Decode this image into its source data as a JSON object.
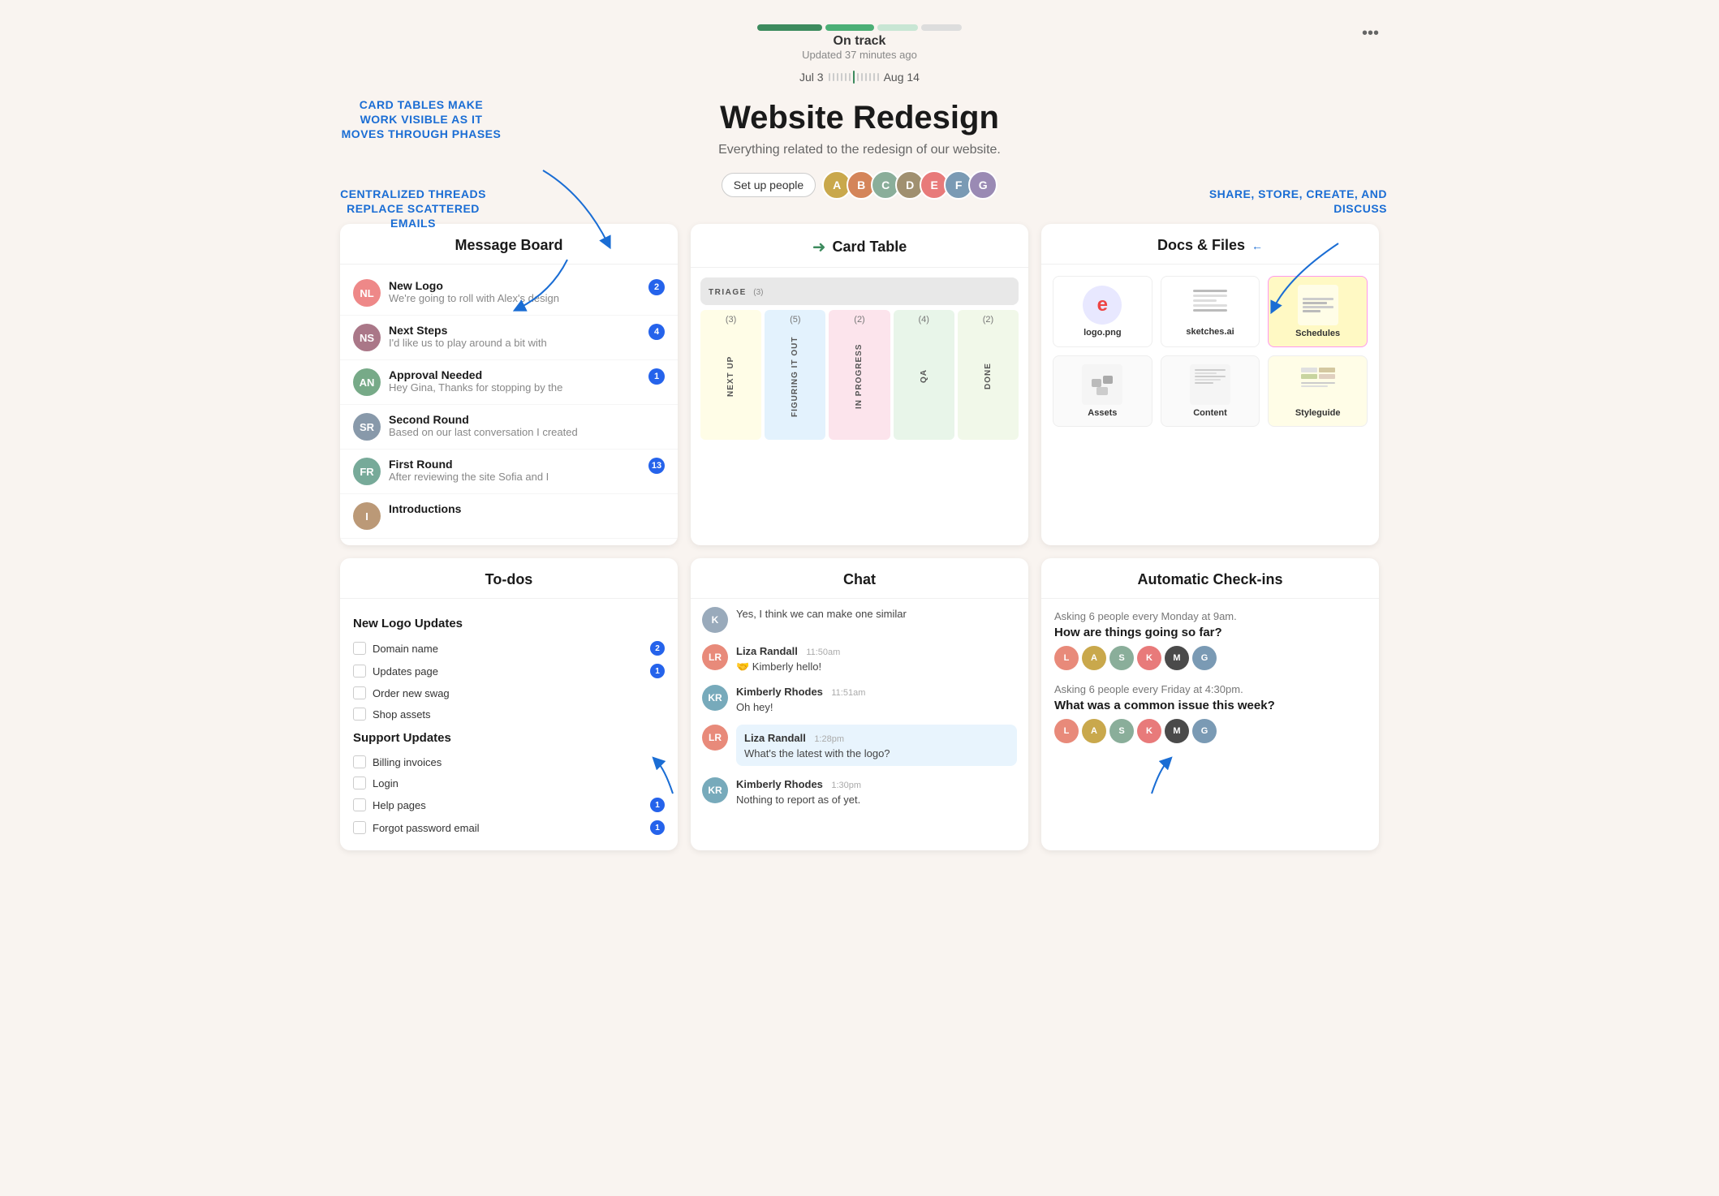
{
  "header": {
    "status_label": "On track",
    "status_updated": "Updated 37 minutes ago",
    "more_icon": "•••",
    "timeline_start": "Jul 3",
    "timeline_end": "Aug 14",
    "project_title": "Website Redesign",
    "project_subtitle": "Everything related to the redesign of our website.",
    "set_up_people": "Set up people"
  },
  "annotations": {
    "ann1": "CARD TABLES MAKE WORK VISIBLE AS IT MOVES THROUGH PHASES",
    "ann2": "CENTRALIZED THREADS REPLACE SCATTERED EMAILS",
    "ann3": "SHARE, STORE, CREATE, AND DISCUSS"
  },
  "message_board": {
    "title": "Message Board",
    "messages": [
      {
        "title": "New Logo",
        "preview": "We're going to roll with Alex's design",
        "badge": "2",
        "color": "#e88"
      },
      {
        "title": "Next Steps",
        "preview": "I'd like us to play around a bit with",
        "badge": "4",
        "color": "#a78"
      },
      {
        "title": "Approval Needed",
        "preview": "Hey Gina, Thanks for stopping by the",
        "badge": "1",
        "color": "#7a8"
      },
      {
        "title": "Second Round",
        "preview": "Based on our last conversation I created",
        "badge": "",
        "color": "#89a"
      },
      {
        "title": "First Round",
        "preview": "After reviewing the site Sofia and I",
        "badge": "13",
        "color": "#7a9"
      },
      {
        "title": "Introductions",
        "preview": "",
        "badge": "",
        "color": "#b97"
      }
    ]
  },
  "card_table": {
    "title": "Card Table",
    "triage_label": "TRIAGE",
    "triage_count": "(3)",
    "columns": [
      {
        "label": "NEXT UP",
        "count": "(3)",
        "color": "col-yellow"
      },
      {
        "label": "FIGURING IT OUT",
        "count": "(5)",
        "color": "col-blue"
      },
      {
        "label": "IN PROGRESS",
        "count": "(2)",
        "color": "col-pink"
      },
      {
        "label": "QA",
        "count": "(4)",
        "color": "col-green-light"
      },
      {
        "label": "DONE",
        "count": "(2)",
        "color": "col-green2"
      }
    ]
  },
  "docs_files": {
    "title": "Docs & Files",
    "items": [
      {
        "name": "logo.png",
        "type": "logo",
        "id": "logo"
      },
      {
        "name": "sketches.ai",
        "type": "sketch",
        "id": "sketch"
      },
      {
        "name": "Schedules",
        "type": "schedules",
        "id": "schedules"
      },
      {
        "name": "Assets",
        "type": "assets",
        "id": "assets"
      },
      {
        "name": "Content",
        "type": "content",
        "id": "content"
      },
      {
        "name": "Styleguide",
        "type": "styleguide",
        "id": "styleguide"
      }
    ]
  },
  "todos": {
    "title": "To-dos",
    "groups": [
      {
        "title": "New Logo Updates",
        "items": [
          {
            "text": "Domain name",
            "badge": "2"
          },
          {
            "text": "Updates page",
            "badge": "1"
          },
          {
            "text": "Order new swag",
            "badge": ""
          },
          {
            "text": "Shop assets",
            "badge": ""
          }
        ]
      },
      {
        "title": "Support Updates",
        "items": [
          {
            "text": "Billing invoices",
            "badge": ""
          },
          {
            "text": "Login",
            "badge": ""
          },
          {
            "text": "Help pages",
            "badge": "1"
          },
          {
            "text": "Forgot password email",
            "badge": "1"
          }
        ]
      }
    ]
  },
  "chat": {
    "title": "Chat",
    "messages": [
      {
        "sender": "",
        "time": "",
        "text": "Yes, I think we can make one similar",
        "avatar_color": "#9ab",
        "initials": "K"
      },
      {
        "sender": "Liza Randall",
        "time": "11:50am",
        "text": "🤝 Kimberly hello!",
        "avatar_color": "#e88a7a",
        "initials": "LR",
        "highlighted": false
      },
      {
        "sender": "Kimberly Rhodes",
        "time": "11:51am",
        "text": "Oh hey!",
        "avatar_color": "#7ab",
        "initials": "KR",
        "highlighted": false
      },
      {
        "sender": "Liza Randall",
        "time": "1:28pm",
        "text": "What's the latest with the logo?",
        "avatar_color": "#e88a7a",
        "initials": "LR",
        "highlighted": true
      },
      {
        "sender": "Kimberly Rhodes",
        "time": "1:30pm",
        "text": "Nothing to report as of yet.",
        "avatar_color": "#7ab",
        "initials": "KR",
        "highlighted": false
      }
    ]
  },
  "checkins": {
    "title": "Automatic Check-ins",
    "sections": [
      {
        "asking": "Asking 6 people every Monday at 9am.",
        "question": "How are things going so far?",
        "avatars": [
          "#e88a7a",
          "#c9a84c",
          "#8aae9a",
          "#e87a7a",
          "#4a4a4a",
          "#7a9ab4"
        ]
      },
      {
        "asking": "Asking 6 people every Friday at 4:30pm.",
        "question": "What was a common issue this week?",
        "avatars": [
          "#e88a7a",
          "#c9a84c",
          "#8aae9a",
          "#e87a7a",
          "#4a4a4a",
          "#7a9ab4"
        ]
      }
    ]
  },
  "avatars": [
    {
      "color": "#c9a84c",
      "initials": "A"
    },
    {
      "color": "#d4855a",
      "initials": "B"
    },
    {
      "color": "#8aae9a",
      "initials": "C"
    },
    {
      "color": "#a09070",
      "initials": "D"
    },
    {
      "color": "#e87a7a",
      "initials": "E"
    },
    {
      "color": "#7a9ab4",
      "initials": "F"
    },
    {
      "color": "#9a8ab4",
      "initials": "G"
    }
  ]
}
